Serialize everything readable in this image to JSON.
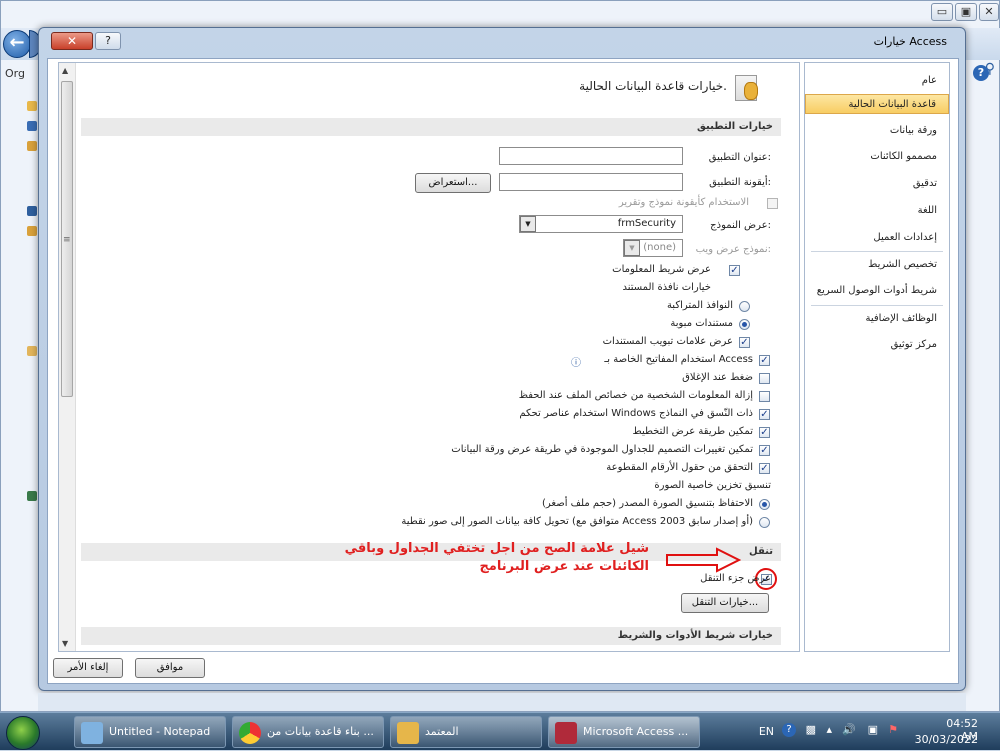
{
  "background_window": {
    "org_label": "Org",
    "caption_buttons": [
      "▭",
      "▣",
      "✕"
    ]
  },
  "dialog": {
    "title": "خيارات Access",
    "close_label": "✕",
    "help_label": "?",
    "nav": [
      {
        "label": "عام",
        "selected": false
      },
      {
        "label": "قاعدة البيانات الحالية",
        "selected": true
      },
      {
        "label": "ورقة بيانات",
        "selected": false
      },
      {
        "label": "مصممو الكائنات",
        "selected": false
      },
      {
        "label": "تدقيق",
        "selected": false
      },
      {
        "label": "اللغة",
        "selected": false
      },
      {
        "label": "إعدادات العميل",
        "selected": false
      },
      {
        "label": "تخصيص الشريط",
        "selected": false
      },
      {
        "label": "شريط أدوات الوصول السريع",
        "selected": false
      },
      {
        "label": "الوظائف الإضافية",
        "selected": false
      },
      {
        "label": "مركز توثيق",
        "selected": false
      }
    ],
    "main": {
      "title": "خيارات قاعدة البيانات الحالية.",
      "section_app": "خيارات التطبيق",
      "app_title_label": "عنوان التطبيق:",
      "app_title_value": "",
      "app_icon_label": "أيقونة التطبيق:",
      "app_icon_value": "",
      "browse_button": "استعراض...",
      "use_as_icon": "الاستخدام كأيقونة نموذج وتقرير",
      "display_form_label": "عرض النموذج:",
      "display_form_value": "frmSecurity",
      "web_form_label": "نموذج عرض ويب:",
      "web_form_value": "(none)",
      "status_bar": "عرض شريط المعلومات",
      "doc_window_options": "خيارات نافذة المستند",
      "overlapping": "النوافذ المتراكبة",
      "tabbed": "مستندات مبوبة",
      "doc_tabs": "عرض علامات تبويب المستندات",
      "access_keys": "استخدام المفاتيح الخاصة بـ Access",
      "compact_close": "ضغط عند الإغلاق",
      "remove_personal": "إزالة المعلومات الشخصية من خصائص الملف عند الحفظ",
      "windows_themed": "استخدام عناصر تحكم Windows ذات النّسق في النماذج",
      "layout_view": "تمكين طريقة عرض التخطيط",
      "design_changes": "تمكين تغييرات التصميم للجداول الموجودة في طريقة عرض ورقة البيانات",
      "truncated_fields": "التحقق من حقول الأرقام المقطوعة",
      "picture_format": "تنسيق تخزين خاصية الصورة",
      "preserve_format": "الاحتفاظ بتنسيق الصورة المصدر (حجم ملف أصغر)",
      "convert_bitmaps": "تحويل كافة بيانات الصور إلى صور نقطية (متوافق مع Access 2003 أو إصدار سابق)",
      "section_nav": "تنقل",
      "show_nav_pane": "عرض جزء التنقل",
      "nav_options_button": "خيارات التنقل...",
      "section_ribbon": "خيارات شريط الأدوات والشريط"
    },
    "annotation_line1": "شيل علامة الصح من اجل تختفي الجداول وباقي",
    "annotation_line2": "الكائنات عند عرض البرنامج",
    "ok_button": "موافق",
    "cancel_button": "إلغاء الأمر"
  },
  "taskbar": {
    "items": [
      {
        "label": "Untitled - Notepad"
      },
      {
        "label": "بناء قاعدة بيانات من ..."
      },
      {
        "label": "المعتمد"
      },
      {
        "label": "Microsoft Access ..."
      }
    ],
    "lang": "EN",
    "time": "04:52 AM",
    "date": "30/03/2022"
  }
}
